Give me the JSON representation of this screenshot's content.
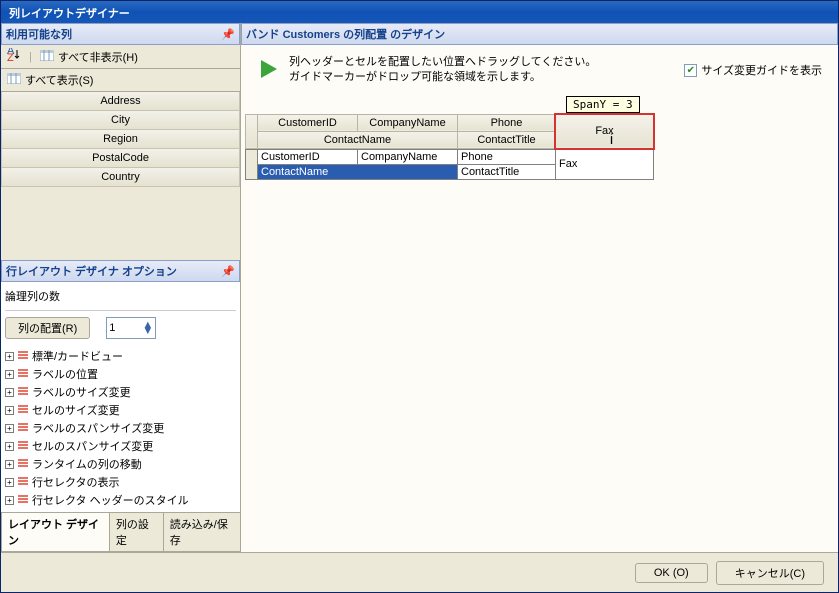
{
  "window": {
    "title": "列レイアウトデザイナー"
  },
  "leftTop": {
    "header": "利用可能な列",
    "hideAll": "すべて非表示(H)",
    "showAll": "すべて表示(S)",
    "columns": [
      "Address",
      "City",
      "Region",
      "PostalCode",
      "Country"
    ]
  },
  "options": {
    "header": "行レイアウト デザイナ オプション",
    "logicalCols": "論理列の数",
    "arrangeBtn": "列の配置(R)",
    "countValue": "1",
    "tree": [
      "標準/カードビュー",
      "ラベルの位置",
      "ラベルのサイズ変更",
      "セルのサイズ変更",
      "ラベルのスパンサイズ変更",
      "セルのスパンサイズ変更",
      "ランタイムの列の移動",
      "行セレクタの表示",
      "行セレクタ ヘッダーのスタイル"
    ]
  },
  "tabs": {
    "t1": "レイアウト デザイン",
    "t2": "列の設定",
    "t3": "読み込み/保存"
  },
  "right": {
    "header": "バンド Customers の列配置 のデザイン",
    "msg1": "列ヘッダーとセルを配置したい位置へドラッグしてください。",
    "msg2": "ガイドマーカーがドロップ可能な領域を示します。",
    "chkLabel": "サイズ変更ガイドを表示",
    "spanTip": "SpanY = 3",
    "hdr": {
      "r1c1": "CustomerID",
      "r1c2": "CompanyName",
      "r1c3": "Phone",
      "r1c4": "Fax",
      "r2c1": "ContactName",
      "r2c2": "ContactTitle"
    },
    "dat": {
      "r1c1": "CustomerID",
      "r1c2": "CompanyName",
      "r1c3": "Phone",
      "r1c4": "Fax",
      "r2c1": "ContactName",
      "r2c2": "ContactTitle"
    }
  },
  "footer": {
    "ok": "OK (O)",
    "cancel": "キャンセル(C)"
  }
}
